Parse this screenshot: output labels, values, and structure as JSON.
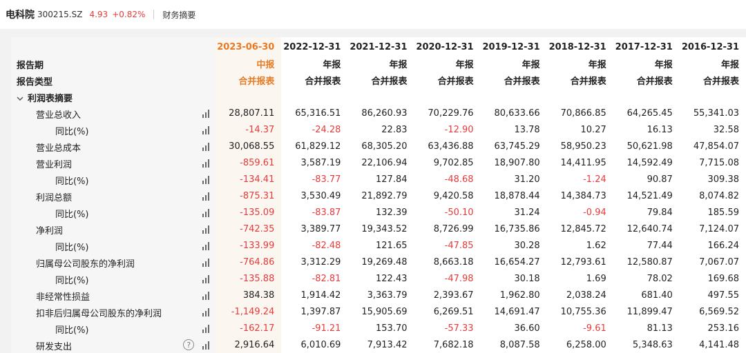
{
  "header": {
    "stock_name": "电科院",
    "stock_code": "300215.SZ",
    "price": "4.93",
    "change": "+0.82%",
    "section": "财务摘要"
  },
  "columns": [
    {
      "date": "2023-06-30",
      "period": "中报",
      "type": "合并报表"
    },
    {
      "date": "2022-12-31",
      "period": "年报",
      "type": "合并报表"
    },
    {
      "date": "2021-12-31",
      "period": "年报",
      "type": "合并报表"
    },
    {
      "date": "2020-12-31",
      "period": "年报",
      "type": "合并报表"
    },
    {
      "date": "2019-12-31",
      "period": "年报",
      "type": "合并报表"
    },
    {
      "date": "2018-12-31",
      "period": "年报",
      "type": "合并报表"
    },
    {
      "date": "2017-12-31",
      "period": "年报",
      "type": "合并报表"
    },
    {
      "date": "2016-12-31",
      "period": "年报",
      "type": "合并报表"
    }
  ],
  "labels": {
    "period_label": "报告期",
    "type_label": "报告类型",
    "group_label": "利润表摘要",
    "help_glyph": "?"
  },
  "rows": [
    {
      "label": "营业总收入",
      "level": 1,
      "values": [
        "28,807.11",
        "65,316.51",
        "86,260.93",
        "70,229.76",
        "80,633.66",
        "70,866.85",
        "64,265.45",
        "55,341.03"
      ]
    },
    {
      "label": "同比(%)",
      "level": 2,
      "values": [
        "-14.37",
        "-24.28",
        "22.83",
        "-12.90",
        "13.78",
        "10.27",
        "16.13",
        "32.58"
      ]
    },
    {
      "label": "营业总成本",
      "level": 1,
      "values": [
        "30,068.55",
        "61,829.12",
        "68,305.20",
        "63,436.88",
        "63,745.29",
        "58,950.23",
        "50,621.98",
        "47,854.07"
      ]
    },
    {
      "label": "营业利润",
      "level": 1,
      "values": [
        "-859.61",
        "3,587.19",
        "22,106.94",
        "9,702.85",
        "18,907.80",
        "14,411.95",
        "14,592.49",
        "7,715.08"
      ]
    },
    {
      "label": "同比(%)",
      "level": 2,
      "values": [
        "-134.41",
        "-83.77",
        "127.84",
        "-48.68",
        "31.20",
        "-1.24",
        "90.87",
        "309.38"
      ]
    },
    {
      "label": "利润总额",
      "level": 1,
      "values": [
        "-875.31",
        "3,530.49",
        "21,892.79",
        "9,420.58",
        "18,878.44",
        "14,384.73",
        "14,521.49",
        "8,074.82"
      ]
    },
    {
      "label": "同比(%)",
      "level": 2,
      "values": [
        "-135.09",
        "-83.87",
        "132.39",
        "-50.10",
        "31.24",
        "-0.94",
        "79.84",
        "185.59"
      ]
    },
    {
      "label": "净利润",
      "level": 1,
      "values": [
        "-742.35",
        "3,389.77",
        "19,343.52",
        "8,726.99",
        "16,735.86",
        "12,845.72",
        "12,640.74",
        "7,124.07"
      ]
    },
    {
      "label": "同比(%)",
      "level": 2,
      "values": [
        "-133.99",
        "-82.48",
        "121.65",
        "-47.85",
        "30.28",
        "1.62",
        "77.44",
        "166.24"
      ]
    },
    {
      "label": "归属母公司股东的净利润",
      "level": 1,
      "values": [
        "-764.86",
        "3,312.29",
        "19,269.48",
        "8,663.18",
        "16,654.27",
        "12,793.61",
        "12,580.87",
        "7,067.07"
      ]
    },
    {
      "label": "同比(%)",
      "level": 2,
      "values": [
        "-135.88",
        "-82.81",
        "122.43",
        "-47.98",
        "30.18",
        "1.69",
        "78.02",
        "169.68"
      ]
    },
    {
      "label": "非经常性损益",
      "level": 1,
      "values": [
        "384.38",
        "1,914.42",
        "3,363.79",
        "2,393.67",
        "1,962.80",
        "2,038.24",
        "681.40",
        "497.55"
      ]
    },
    {
      "label": "扣非后归属母公司股东的净利润",
      "level": 1,
      "values": [
        "-1,149.24",
        "1,397.87",
        "15,905.69",
        "6,269.51",
        "14,691.47",
        "10,755.36",
        "11,899.47",
        "6,569.52"
      ]
    },
    {
      "label": "同比(%)",
      "level": 2,
      "values": [
        "-162.17",
        "-91.21",
        "153.70",
        "-57.33",
        "36.60",
        "-9.61",
        "81.13",
        "253.16"
      ]
    },
    {
      "label": "研发支出",
      "level": 1,
      "help": true,
      "values": [
        "2,916.64",
        "6,010.69",
        "7,913.42",
        "7,682.18",
        "8,087.58",
        "6,258.00",
        "5,348.63",
        "4,141.48"
      ]
    }
  ],
  "colors": {
    "negative": "#e63b3b",
    "current_period": "#e87a23",
    "label_bg": "#f6f6f6"
  }
}
